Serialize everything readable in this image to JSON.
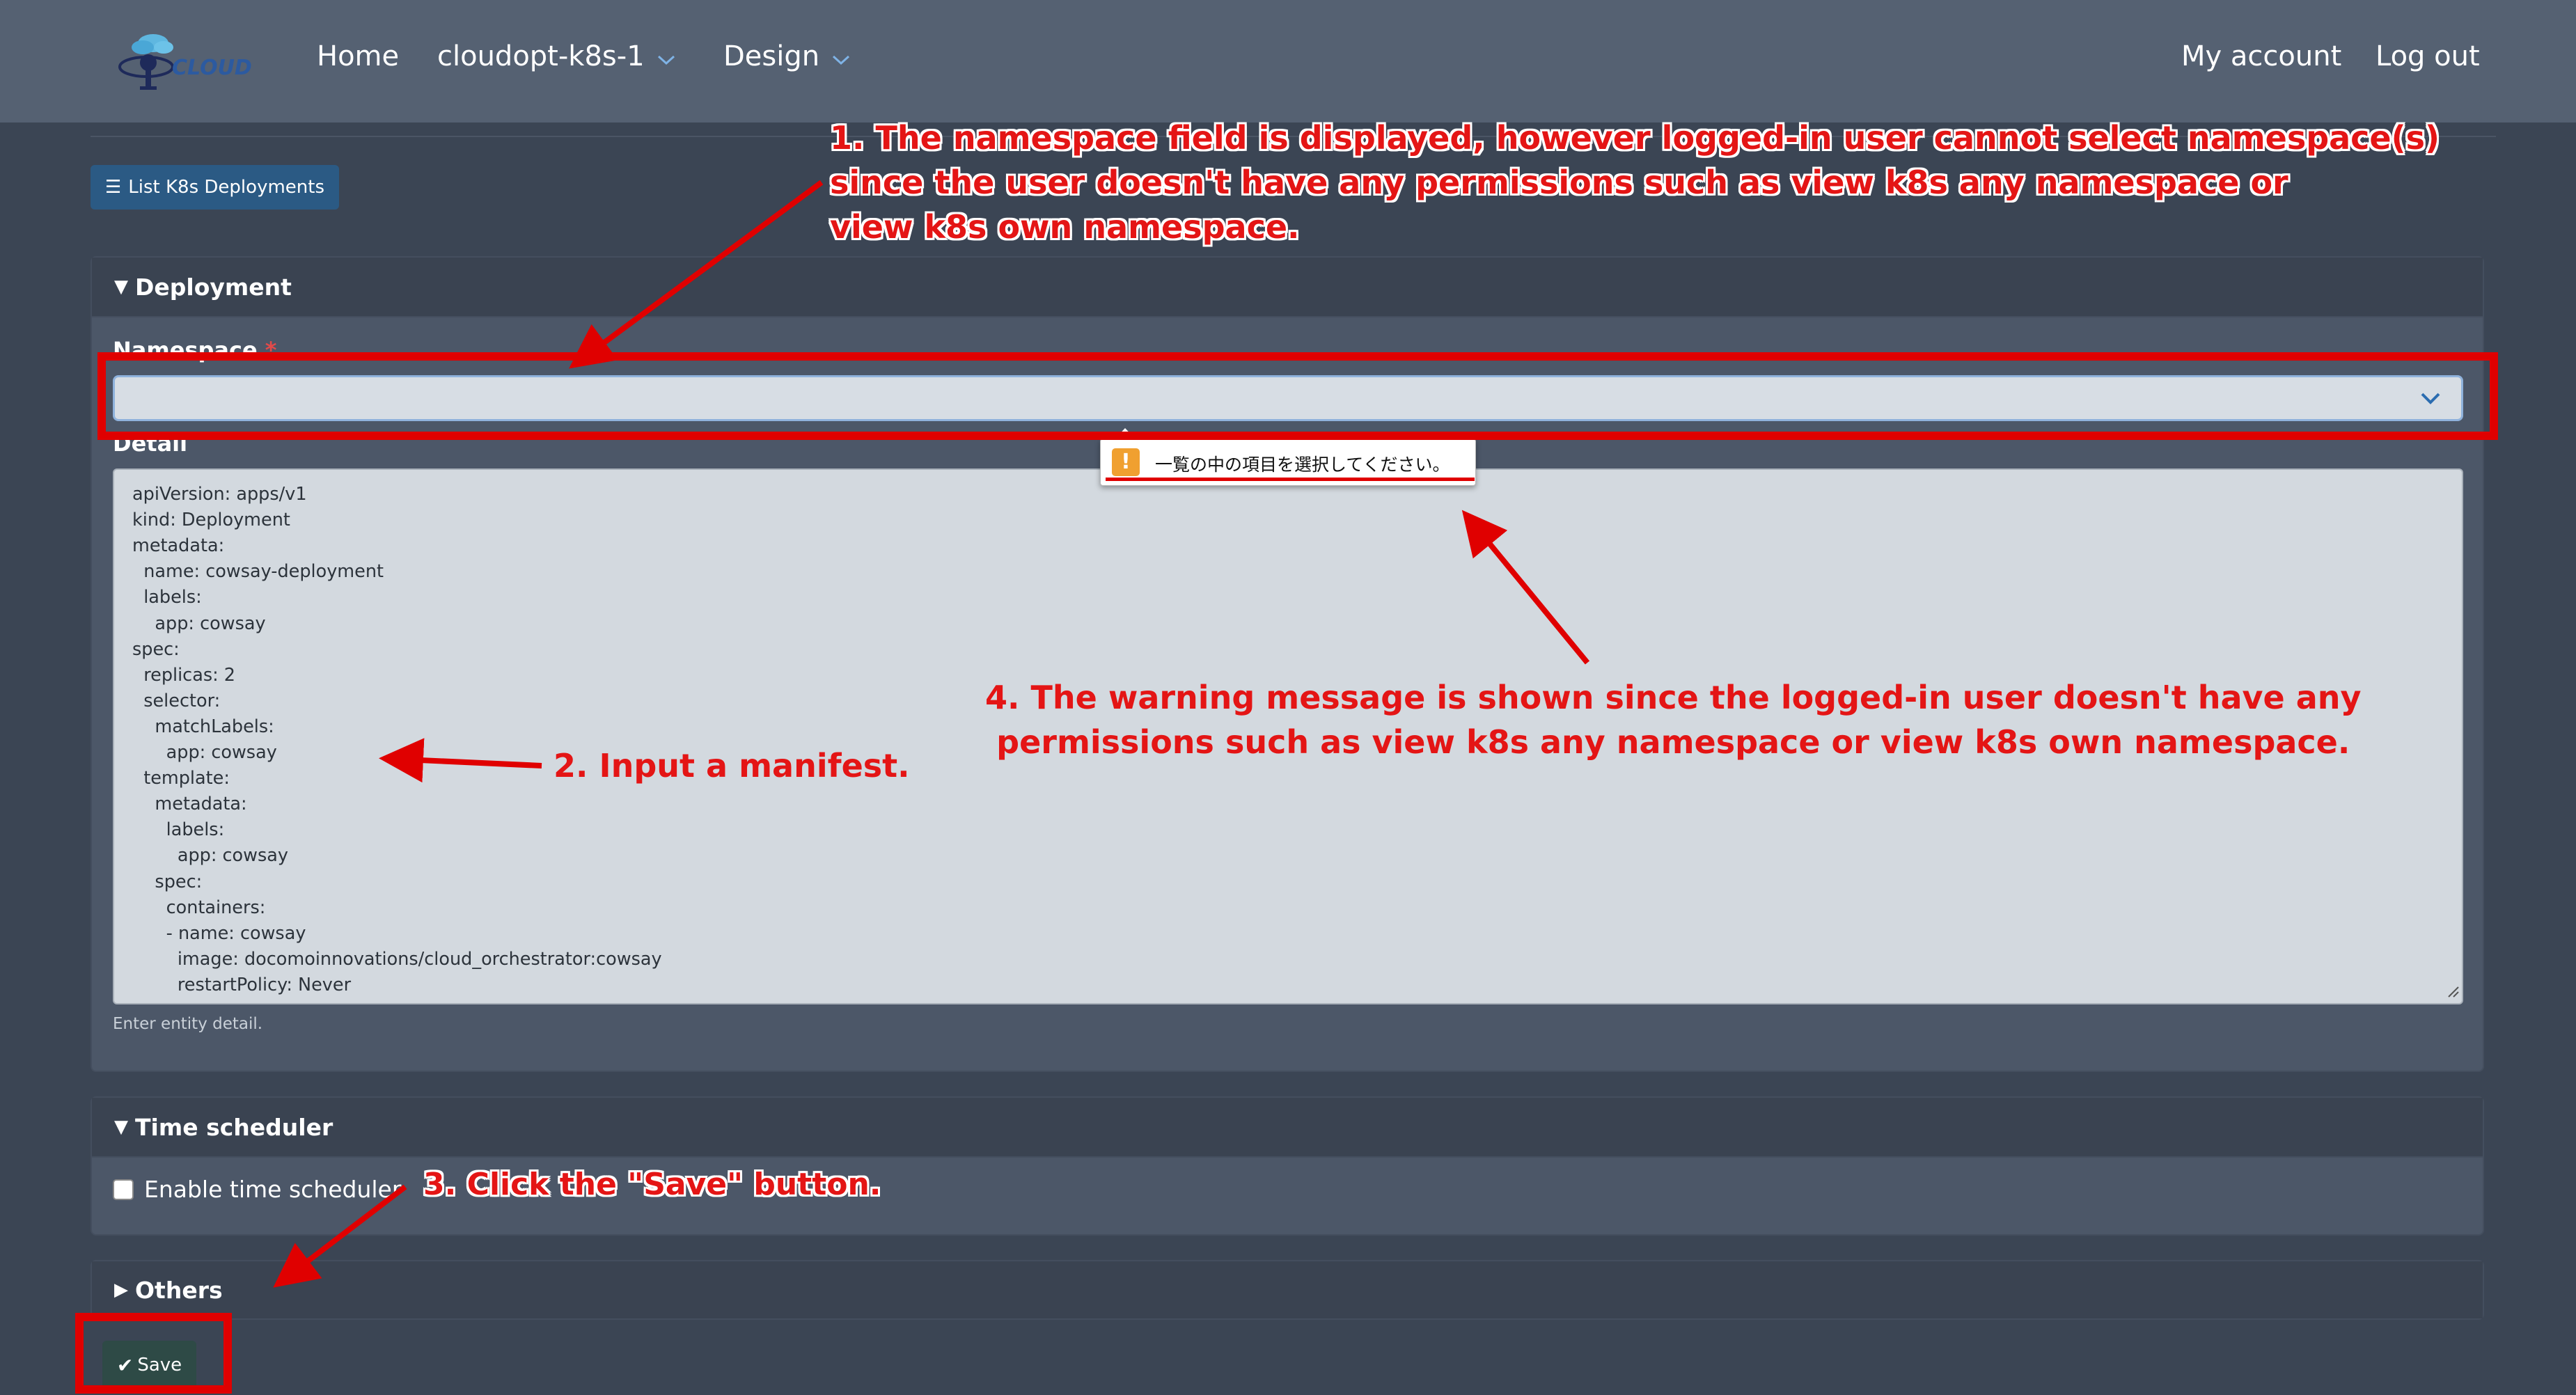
{
  "navbar": {
    "logo_text": "CLOUD",
    "home": "Home",
    "cluster": "cloudopt-k8s-1",
    "design": "Design",
    "my_account": "My account",
    "log_out": "Log out"
  },
  "list_button": {
    "label": "List K8s Deployments"
  },
  "deployment": {
    "title": "Deployment",
    "namespace_label": "Namespace",
    "detail_label": "Detail",
    "manifest_lines": [
      "apiVersion: apps/v1",
      "kind: Deployment",
      "metadata:",
      "  name: cowsay-deployment",
      "  labels:",
      "    app: cowsay",
      "spec:",
      "  replicas: 2",
      "  selector:",
      "    matchLabels:",
      "      app: cowsay",
      "  template:",
      "    metadata:",
      "      labels:",
      "        app: cowsay",
      "    spec:",
      "      containers:",
      "      - name: cowsay",
      "        image: docomoinnovations/cloud_orchestrator:cowsay",
      "        restartPolicy: Never"
    ],
    "help": "Enter entity detail.",
    "validation_message": "一覧の中の項目を選択してください。"
  },
  "time_scheduler": {
    "title": "Time scheduler",
    "checkbox_label": "Enable time scheduler"
  },
  "others": {
    "title": "Others"
  },
  "save_button": {
    "label": "Save"
  },
  "annotations": {
    "note1": [
      "1. The namespace field is displayed, however logged-in user cannot select namespace(s)",
      "since the user doesn't have any permissions such as view k8s any namespace or",
      "view k8s own namespace."
    ],
    "note2": "2. Input a manifest.",
    "note3": "3. Click the \"Save\" button.",
    "note4": [
      "4. The warning message is shown since the logged-in user doesn't have any",
      "permissions such as view k8s any namespace or view k8s own namespace."
    ]
  },
  "colors": {
    "navbar": "#556172",
    "background": "#3b4554",
    "panel": "#4c5768",
    "panel_header": "#3a4351",
    "list_button": "#2b5a84",
    "save_button": "#2e4a46",
    "annotation_red": "#e41515"
  }
}
